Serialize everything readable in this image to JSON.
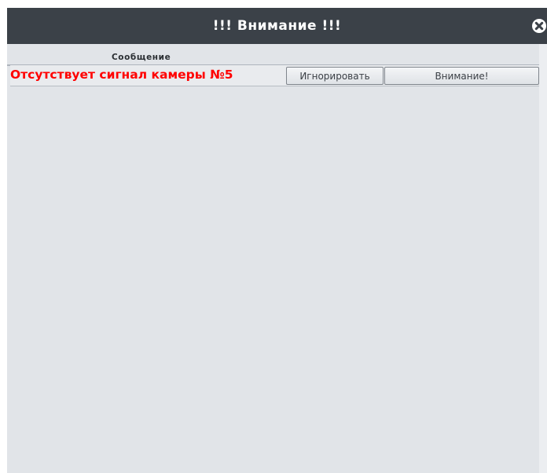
{
  "window": {
    "title": "!!! Внимание !!!",
    "colors": {
      "titlebar": "#3b4148",
      "background": "#e1e4e8",
      "message": "#ff0000"
    }
  },
  "table": {
    "column_header": "Сообщение",
    "rows": [
      {
        "message": "Отсутствует сигнал камеры №5",
        "ignore_label": "Игнорировать",
        "attention_label": "Внимание!"
      }
    ]
  },
  "icons": {
    "close": "close-icon"
  }
}
